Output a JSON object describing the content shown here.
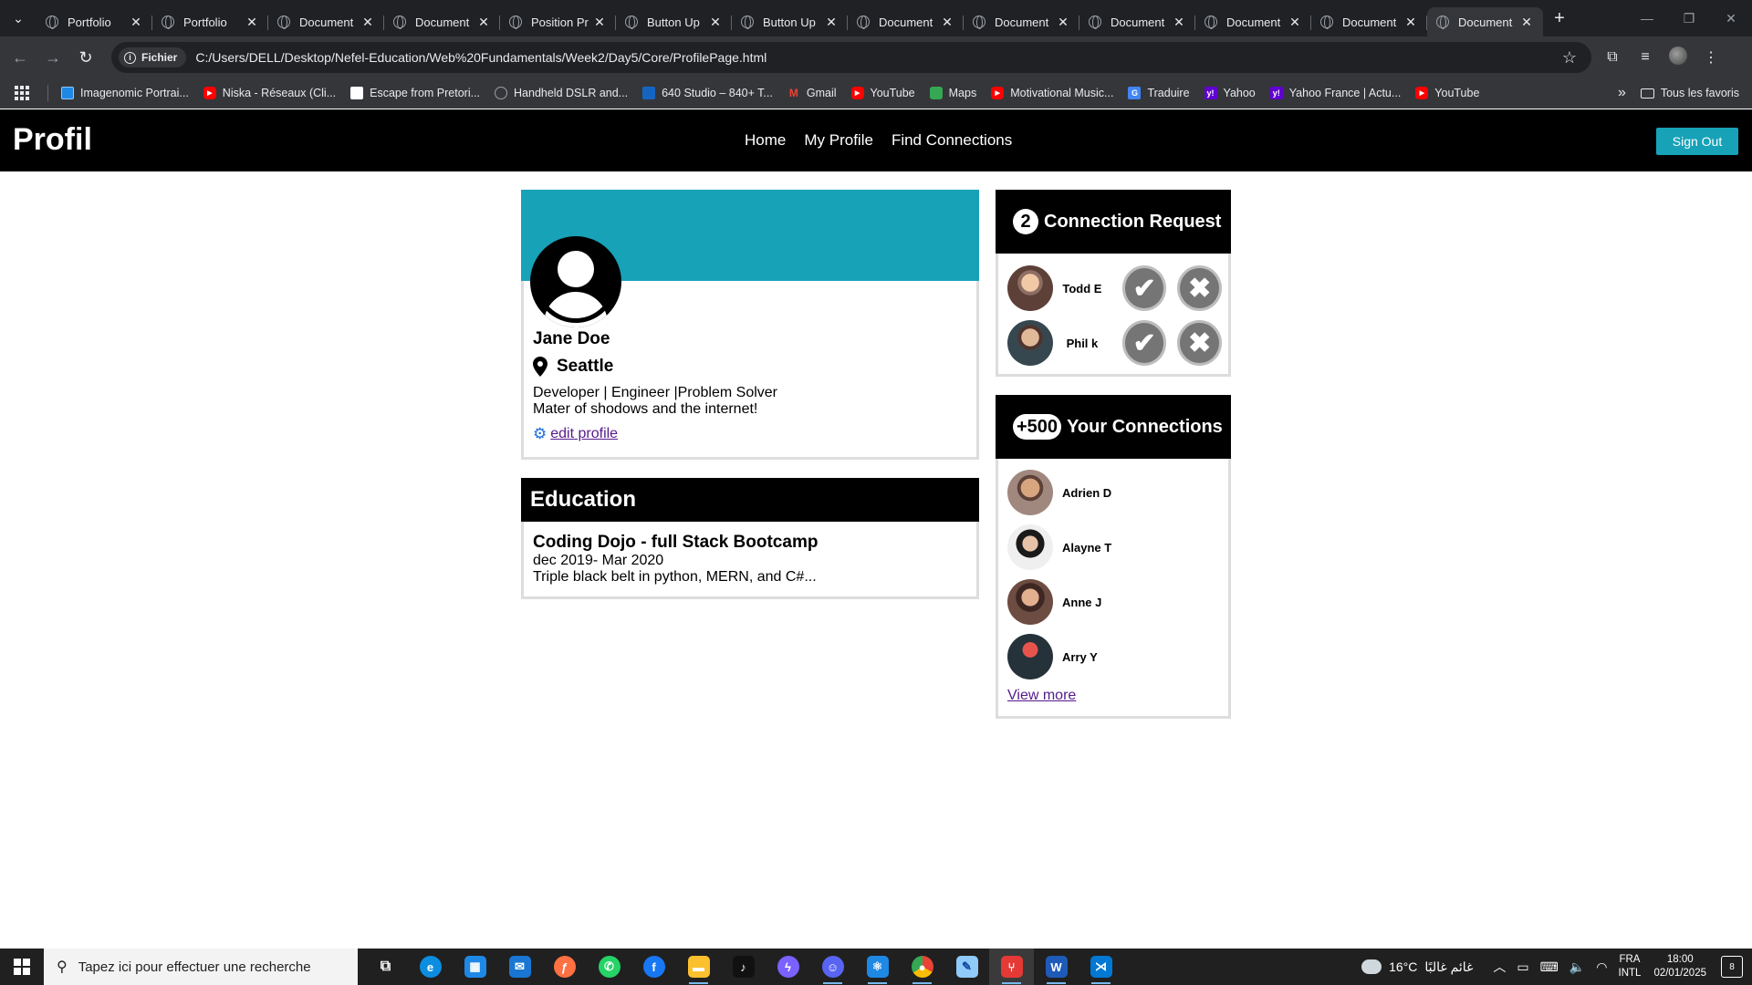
{
  "browser": {
    "tabs": [
      {
        "title": "Portfolio"
      },
      {
        "title": "Portfolio"
      },
      {
        "title": "Document"
      },
      {
        "title": "Document"
      },
      {
        "title": "Position Pr"
      },
      {
        "title": "Button Up"
      },
      {
        "title": "Button Up"
      },
      {
        "title": "Document"
      },
      {
        "title": "Document"
      },
      {
        "title": "Document"
      },
      {
        "title": "Document"
      },
      {
        "title": "Document"
      },
      {
        "title": "Document"
      }
    ],
    "active_tab_index": 12,
    "address": {
      "chip_label": "Fichier",
      "url": "C:/Users/DELL/Desktop/Nefel-Education/Web%20Fundamentals/Week2/Day5/Core/ProfilePage.html"
    },
    "bookmarks": [
      {
        "label": "Imagenomic Portrai...",
        "icon": "square-icon"
      },
      {
        "label": "Niska - Réseaux (Cli...",
        "icon": "youtube-icon"
      },
      {
        "label": "Escape from Pretori...",
        "icon": "page-icon"
      },
      {
        "label": "Handheld DSLR and...",
        "icon": "globe-icon"
      },
      {
        "label": "640 Studio – 840+ T...",
        "icon": "site-icon"
      },
      {
        "label": "Gmail",
        "icon": "gmail-icon"
      },
      {
        "label": "YouTube",
        "icon": "youtube-icon"
      },
      {
        "label": "Maps",
        "icon": "maps-icon"
      },
      {
        "label": "Motivational Music...",
        "icon": "youtube-icon"
      },
      {
        "label": "Traduire",
        "icon": "translate-icon"
      },
      {
        "label": "Yahoo",
        "icon": "yahoo-icon"
      },
      {
        "label": "Yahoo France | Actu...",
        "icon": "yahoo-icon"
      },
      {
        "label": "YouTube",
        "icon": "youtube-icon"
      }
    ],
    "all_bookmarks_label": "Tous les favoris"
  },
  "site": {
    "brand": "Profil",
    "nav": [
      "Home",
      "My Profile",
      "Find Connections"
    ],
    "sign_out": "Sign Out",
    "accent_color": "#17a2b8"
  },
  "profile": {
    "name": "Jane Doe",
    "location": "Seattle",
    "bio_line1": "Developer | Engineer |Problem Solver",
    "bio_line2": "Mater of shodows and the internet!",
    "edit_label": "edit profile"
  },
  "education": {
    "heading": "Education",
    "school": "Coding Dojo - full Stack Bootcamp",
    "dates": "dec 2019- Mar 2020",
    "description": "Triple black belt in python, MERN, and C#..."
  },
  "requests": {
    "count": "2",
    "heading": "Connection Request",
    "items": [
      {
        "name": "Todd E"
      },
      {
        "name": "Phil k"
      }
    ]
  },
  "connections": {
    "count": "+500",
    "heading": "Your Connections",
    "items": [
      {
        "name": "Adrien D"
      },
      {
        "name": "Alayne T"
      },
      {
        "name": "Anne J"
      },
      {
        "name": "Arry Y"
      }
    ],
    "view_more": "View more"
  },
  "taskbar": {
    "search_placeholder": "Tapez ici pour effectuer une recherche",
    "weather_temp": "16°C",
    "weather_text": "غائم غالبًا",
    "lang_top": "FRA",
    "lang_bottom": "INTL",
    "time": "18:00",
    "date": "02/01/2025",
    "notifications": "8",
    "apps": [
      "task-view",
      "edge",
      "store",
      "mail",
      "firefox",
      "whatsapp",
      "facebook",
      "file-explorer",
      "tiktok",
      "messenger",
      "discord",
      "react",
      "chrome",
      "notepad",
      "git-app",
      "word",
      "vscode"
    ]
  }
}
